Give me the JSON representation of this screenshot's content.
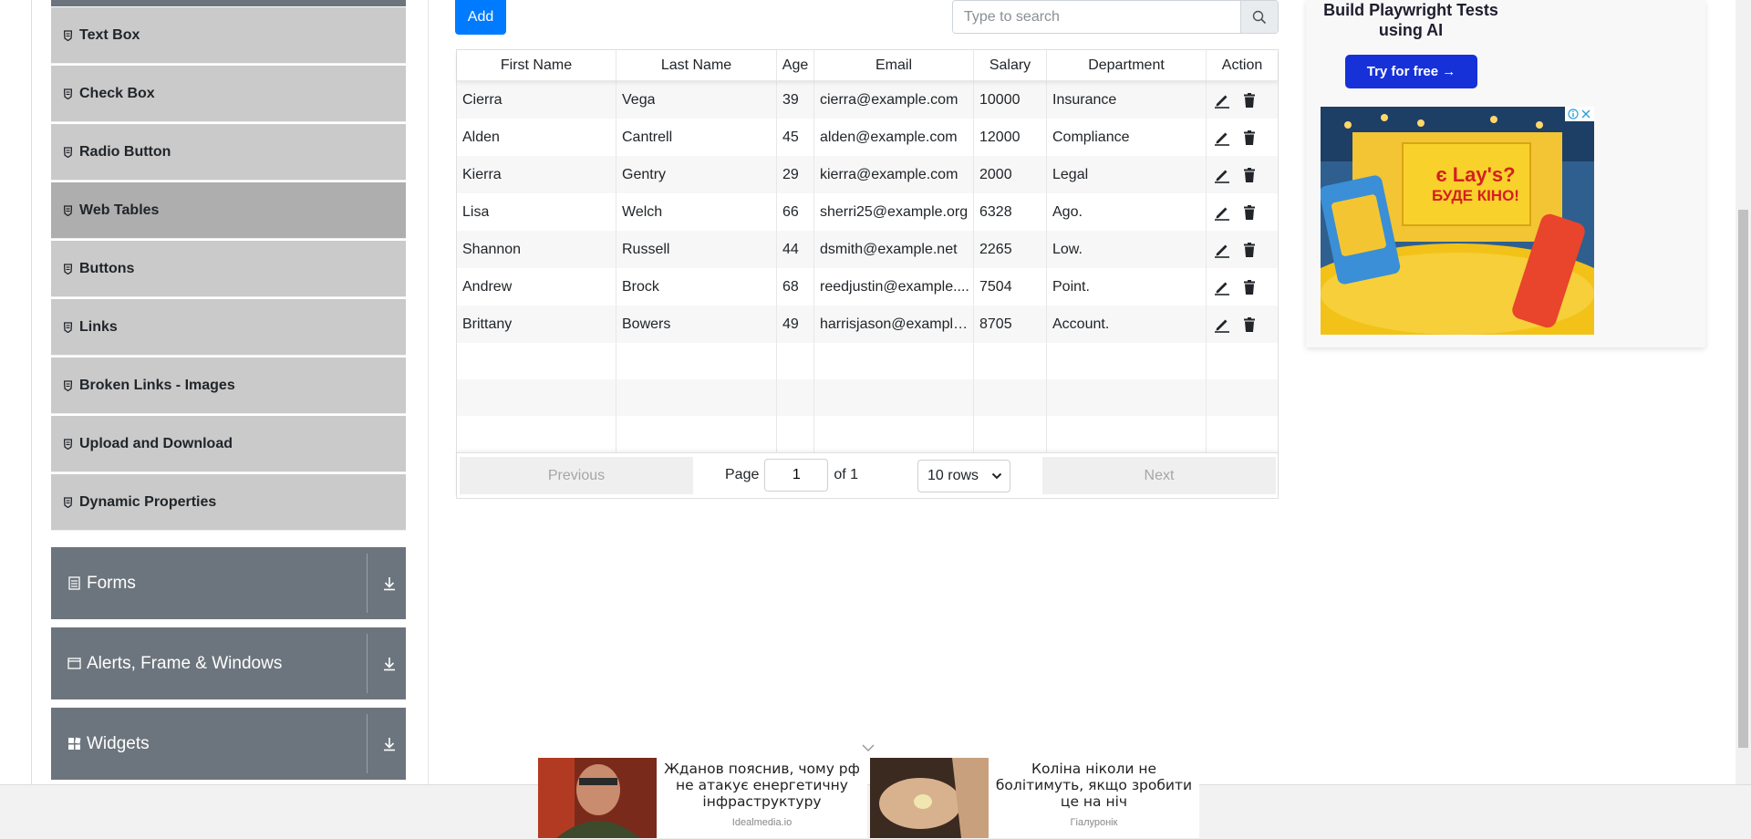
{
  "sidebar": {
    "items": [
      {
        "label": "Text Box",
        "active": false
      },
      {
        "label": "Check Box",
        "active": false
      },
      {
        "label": "Radio Button",
        "active": false
      },
      {
        "label": "Web Tables",
        "active": true
      },
      {
        "label": "Buttons",
        "active": false
      },
      {
        "label": "Links",
        "active": false
      },
      {
        "label": "Broken Links - Images",
        "active": false
      },
      {
        "label": "Upload and Download",
        "active": false
      },
      {
        "label": "Dynamic Properties",
        "active": false
      }
    ],
    "groups": [
      {
        "label": "Forms",
        "icon": "form-icon"
      },
      {
        "label": "Alerts, Frame & Windows",
        "icon": "window-icon"
      },
      {
        "label": "Widgets",
        "icon": "widgets-icon"
      }
    ]
  },
  "toolbar": {
    "add_label": "Add",
    "search_placeholder": "Type to search"
  },
  "table": {
    "headers": [
      "First Name",
      "Last Name",
      "Age",
      "Email",
      "Salary",
      "Department",
      "Action"
    ],
    "rows": [
      [
        "Cierra",
        "Vega",
        "39",
        "cierra@example.com",
        "10000",
        "Insurance"
      ],
      [
        "Alden",
        "Cantrell",
        "45",
        "alden@example.com",
        "12000",
        "Compliance"
      ],
      [
        "Kierra",
        "Gentry",
        "29",
        "kierra@example.com",
        "2000",
        "Legal"
      ],
      [
        "Lisa",
        "Welch",
        "66",
        "sherri25@example.org",
        "6328",
        "Ago."
      ],
      [
        "Shannon",
        "Russell",
        "44",
        "dsmith@example.net",
        "2265",
        "Low."
      ],
      [
        "Andrew",
        "Brock",
        "68",
        "reedjustin@example....",
        "7504",
        "Point."
      ],
      [
        "Brittany",
        "Bowers",
        "49",
        "harrisjason@example....",
        "8705",
        "Account."
      ]
    ],
    "empty_rows": 3
  },
  "pagination": {
    "previous_label": "Previous",
    "next_label": "Next",
    "page_label": "Page",
    "page_value": "1",
    "of_label": "of 1",
    "rows_label": "10 rows"
  },
  "ad": {
    "title": "Build Playwright Tests using AI",
    "cta_label": "Try for free →",
    "banner_text_1": "є Lay's?",
    "banner_text_2": "БУДЕ КІНО!"
  },
  "news": [
    {
      "text": "Жданов пояснив, чому рф не атакує енергетичну інфраструктуру",
      "source": "Idealmedia.io"
    },
    {
      "text": "Коліна ніколи не болітимуть, якщо зробити це на ніч",
      "source": "Гіалуронік"
    }
  ],
  "colors": {
    "accent": "#007bff",
    "sidebar_item": "#cacaca",
    "sidebar_active": "#aeaeae",
    "group_bg": "#6c757d",
    "cta": "#1631d8"
  }
}
